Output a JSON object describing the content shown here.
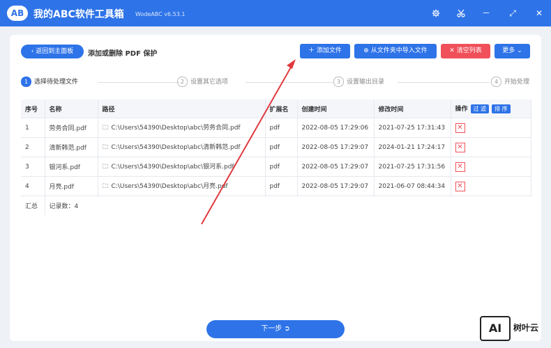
{
  "app": {
    "logo_text": "AB",
    "title": "我的ABC软件工具箱",
    "version": "WodeABC v6.53.1"
  },
  "window_controls": {
    "settings_icon": "gear-icon",
    "tools_icon": "scissors-icon",
    "minimize": "－",
    "maximize": "⤢",
    "close": "✕"
  },
  "header": {
    "back_label": "返回到主面板",
    "page_title": "添加或删除 PDF 保护"
  },
  "toolbar": {
    "add_files": "添加文件",
    "import_folder": "从文件夹中导入文件",
    "clear_list": "清空列表",
    "more": "更多"
  },
  "steps": [
    {
      "num": "1",
      "label": "选择待处理文件"
    },
    {
      "num": "2",
      "label": "设置其它选项"
    },
    {
      "num": "3",
      "label": "设置输出目录"
    },
    {
      "num": "4",
      "label": "开始处理"
    }
  ],
  "table": {
    "headers": {
      "index": "序号",
      "name": "名称",
      "path": "路径",
      "ext": "扩展名",
      "created": "创建时间",
      "modified": "修改时间",
      "action": "操作",
      "filter": "过 滤",
      "sort": "排 序"
    },
    "rows": [
      {
        "index": "1",
        "name": "劳务合同.pdf",
        "path": "C:\\Users\\54390\\Desktop\\abc\\劳务合同.pdf",
        "ext": "pdf",
        "created": "2022-08-05 17:29:06",
        "modified": "2021-07-25 17:31:43"
      },
      {
        "index": "2",
        "name": "清新韩范.pdf",
        "path": "C:\\Users\\54390\\Desktop\\abc\\清新韩范.pdf",
        "ext": "pdf",
        "created": "2022-08-05 17:29:07",
        "modified": "2024-01-21 17:24:17"
      },
      {
        "index": "3",
        "name": "银河系.pdf",
        "path": "C:\\Users\\54390\\Desktop\\abc\\银河系.pdf",
        "ext": "pdf",
        "created": "2022-08-05 17:29:07",
        "modified": "2021-07-25 17:31:56"
      },
      {
        "index": "4",
        "name": "月亮.pdf",
        "path": "C:\\Users\\54390\\Desktop\\abc\\月亮.pdf",
        "ext": "pdf",
        "created": "2022-08-05 17:29:07",
        "modified": "2021-06-07 08:44:34"
      }
    ],
    "summary_label": "汇总",
    "record_count": "记录数：4"
  },
  "footer": {
    "next_label": "下一步"
  },
  "watermark": {
    "logo": "AI",
    "text": "树叶云"
  },
  "colors": {
    "accent": "#2e73e8",
    "danger": "#f0505a",
    "annotation_arrow": "#e0393e"
  }
}
